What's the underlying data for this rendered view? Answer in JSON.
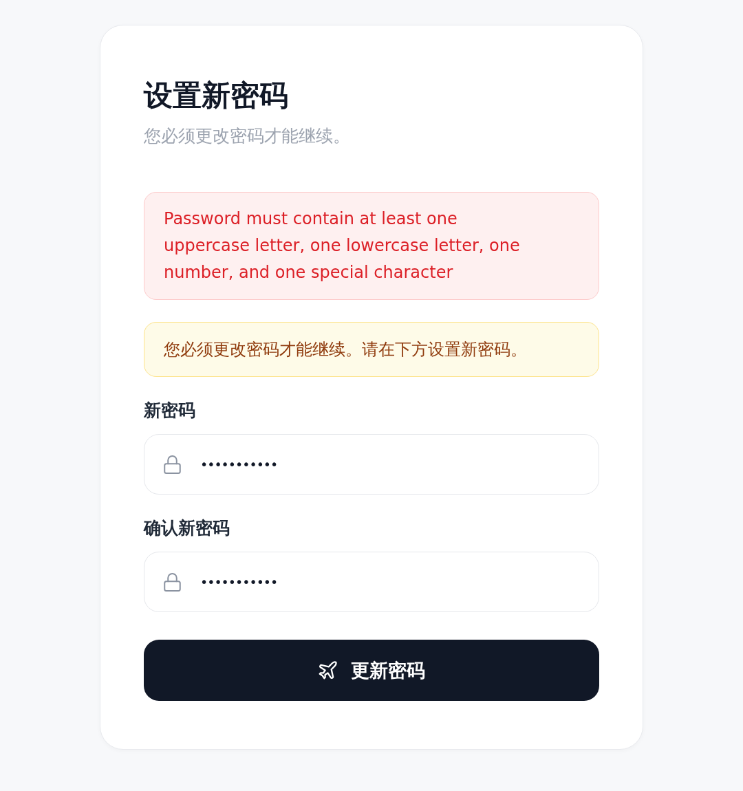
{
  "header": {
    "title": "设置新密码",
    "subtitle": "您必须更改密码才能继续。"
  },
  "alerts": [
    {
      "kind": "error",
      "text": "Password must contain at least one uppercase letter, one lowercase letter, one number, and one special character"
    },
    {
      "kind": "warning",
      "text": "您必须更改密码才能继续。请在下方设置新密码。"
    }
  ],
  "fields": [
    {
      "label": "新密码",
      "value": "•••••••••••"
    },
    {
      "label": "确认新密码",
      "value": "•••••••••••"
    }
  ],
  "submit_button": {
    "label": "更新密码"
  }
}
